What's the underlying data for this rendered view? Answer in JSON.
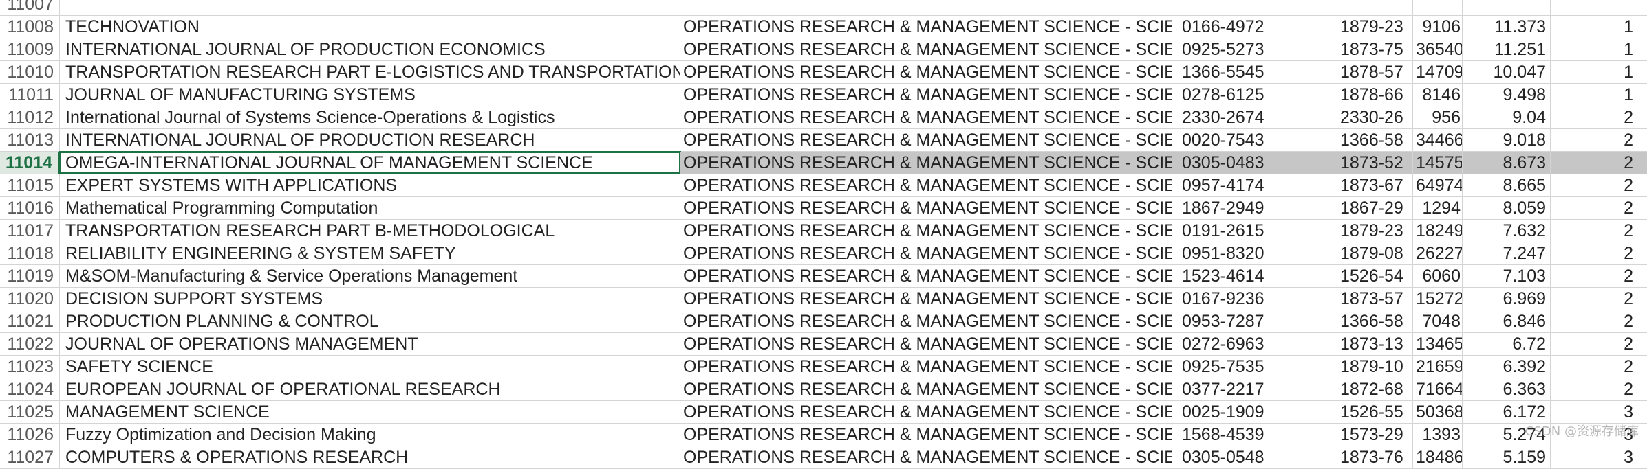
{
  "sheet": {
    "selected_row": "11014",
    "rows": [
      {
        "row": "11007",
        "title": "",
        "category": "",
        "issn": "",
        "eissn": "",
        "cites": "",
        "jif": "",
        "quartile": ""
      },
      {
        "row": "11008",
        "title": "TECHNOVATION",
        "category": "OPERATIONS RESEARCH & MANAGEMENT SCIENCE - SCIE",
        "issn": "0166-4972",
        "eissn": "1879-23",
        "cites": "9106",
        "jif": "11.373",
        "quartile": "1"
      },
      {
        "row": "11009",
        "title": "INTERNATIONAL JOURNAL OF PRODUCTION ECONOMICS",
        "category": "OPERATIONS RESEARCH & MANAGEMENT SCIENCE - SCIE",
        "issn": "0925-5273",
        "eissn": "1873-75",
        "cites": "36540",
        "jif": "11.251",
        "quartile": "1"
      },
      {
        "row": "11010",
        "title": "TRANSPORTATION RESEARCH PART E-LOGISTICS AND TRANSPORTATION REV",
        "category": "OPERATIONS RESEARCH & MANAGEMENT SCIENCE - SCIE",
        "issn": "1366-5545",
        "eissn": "1878-57",
        "cites": "14709",
        "jif": "10.047",
        "quartile": "1"
      },
      {
        "row": "11011",
        "title": "JOURNAL OF MANUFACTURING SYSTEMS",
        "category": "OPERATIONS RESEARCH & MANAGEMENT SCIENCE - SCIE",
        "issn": "0278-6125",
        "eissn": "1878-66",
        "cites": "8146",
        "jif": "9.498",
        "quartile": "1"
      },
      {
        "row": "11012",
        "title": "International Journal of Systems Science-Operations & Logistics",
        "category": "OPERATIONS RESEARCH & MANAGEMENT SCIENCE - SCIE",
        "issn": "2330-2674",
        "eissn": "2330-26",
        "cites": "956",
        "jif": "9.04",
        "quartile": "2"
      },
      {
        "row": "11013",
        "title": "INTERNATIONAL JOURNAL OF PRODUCTION RESEARCH",
        "category": "OPERATIONS RESEARCH & MANAGEMENT SCIENCE - SCIE",
        "issn": "0020-7543",
        "eissn": "1366-58",
        "cites": "34466",
        "jif": "9.018",
        "quartile": "2"
      },
      {
        "row": "11014",
        "title": "OMEGA-INTERNATIONAL JOURNAL OF MANAGEMENT SCIENCE",
        "category": "OPERATIONS RESEARCH & MANAGEMENT SCIENCE - SCIE",
        "issn": "0305-0483",
        "eissn": "1873-52",
        "cites": "14575",
        "jif": "8.673",
        "quartile": "2"
      },
      {
        "row": "11015",
        "title": "EXPERT SYSTEMS WITH APPLICATIONS",
        "category": "OPERATIONS RESEARCH & MANAGEMENT SCIENCE - SCIE",
        "issn": "0957-4174",
        "eissn": "1873-67",
        "cites": "64974",
        "jif": "8.665",
        "quartile": "2"
      },
      {
        "row": "11016",
        "title": "Mathematical Programming Computation",
        "category": "OPERATIONS RESEARCH & MANAGEMENT SCIENCE - SCIE",
        "issn": "1867-2949",
        "eissn": "1867-29",
        "cites": "1294",
        "jif": "8.059",
        "quartile": "2"
      },
      {
        "row": "11017",
        "title": "TRANSPORTATION RESEARCH PART B-METHODOLOGICAL",
        "category": "OPERATIONS RESEARCH & MANAGEMENT SCIENCE - SCIE",
        "issn": "0191-2615",
        "eissn": "1879-23",
        "cites": "18249",
        "jif": "7.632",
        "quartile": "2"
      },
      {
        "row": "11018",
        "title": "RELIABILITY ENGINEERING & SYSTEM SAFETY",
        "category": "OPERATIONS RESEARCH & MANAGEMENT SCIENCE - SCIE",
        "issn": "0951-8320",
        "eissn": "1879-08",
        "cites": "26227",
        "jif": "7.247",
        "quartile": "2"
      },
      {
        "row": "11019",
        "title": "M&SOM-Manufacturing & Service Operations Management",
        "category": "OPERATIONS RESEARCH & MANAGEMENT SCIENCE - SCIE",
        "issn": "1523-4614",
        "eissn": "1526-54",
        "cites": "6060",
        "jif": "7.103",
        "quartile": "2"
      },
      {
        "row": "11020",
        "title": "DECISION SUPPORT SYSTEMS",
        "category": "OPERATIONS RESEARCH & MANAGEMENT SCIENCE - SCIE",
        "issn": "0167-9236",
        "eissn": "1873-57",
        "cites": "15272",
        "jif": "6.969",
        "quartile": "2"
      },
      {
        "row": "11021",
        "title": "PRODUCTION PLANNING & CONTROL",
        "category": "OPERATIONS RESEARCH & MANAGEMENT SCIENCE - SCIE",
        "issn": "0953-7287",
        "eissn": "1366-58",
        "cites": "7048",
        "jif": "6.846",
        "quartile": "2"
      },
      {
        "row": "11022",
        "title": "JOURNAL OF OPERATIONS MANAGEMENT",
        "category": "OPERATIONS RESEARCH & MANAGEMENT SCIENCE - SCIE",
        "issn": "0272-6963",
        "eissn": "1873-13",
        "cites": "13465",
        "jif": "6.72",
        "quartile": "2"
      },
      {
        "row": "11023",
        "title": "SAFETY SCIENCE",
        "category": "OPERATIONS RESEARCH & MANAGEMENT SCIENCE - SCIE",
        "issn": "0925-7535",
        "eissn": "1879-10",
        "cites": "21659",
        "jif": "6.392",
        "quartile": "2"
      },
      {
        "row": "11024",
        "title": "EUROPEAN JOURNAL OF OPERATIONAL RESEARCH",
        "category": "OPERATIONS RESEARCH & MANAGEMENT SCIENCE - SCIE",
        "issn": "0377-2217",
        "eissn": "1872-68",
        "cites": "71664",
        "jif": "6.363",
        "quartile": "2"
      },
      {
        "row": "11025",
        "title": "MANAGEMENT SCIENCE",
        "category": "OPERATIONS RESEARCH & MANAGEMENT SCIENCE - SCIE",
        "issn": "0025-1909",
        "eissn": "1526-55",
        "cites": "50368",
        "jif": "6.172",
        "quartile": "3"
      },
      {
        "row": "11026",
        "title": "Fuzzy Optimization and Decision Making",
        "category": "OPERATIONS RESEARCH & MANAGEMENT SCIENCE - SCIE",
        "issn": "1568-4539",
        "eissn": "1573-29",
        "cites": "1393",
        "jif": "5.274",
        "quartile": "3"
      },
      {
        "row": "11027",
        "title": "COMPUTERS & OPERATIONS RESEARCH",
        "category": "OPERATIONS RESEARCH & MANAGEMENT SCIENCE - SCIE",
        "issn": "0305-0548",
        "eissn": "1873-76",
        "cites": "18486",
        "jif": "5.159",
        "quartile": "3"
      }
    ]
  },
  "watermark": "CSDN @资源存储库"
}
